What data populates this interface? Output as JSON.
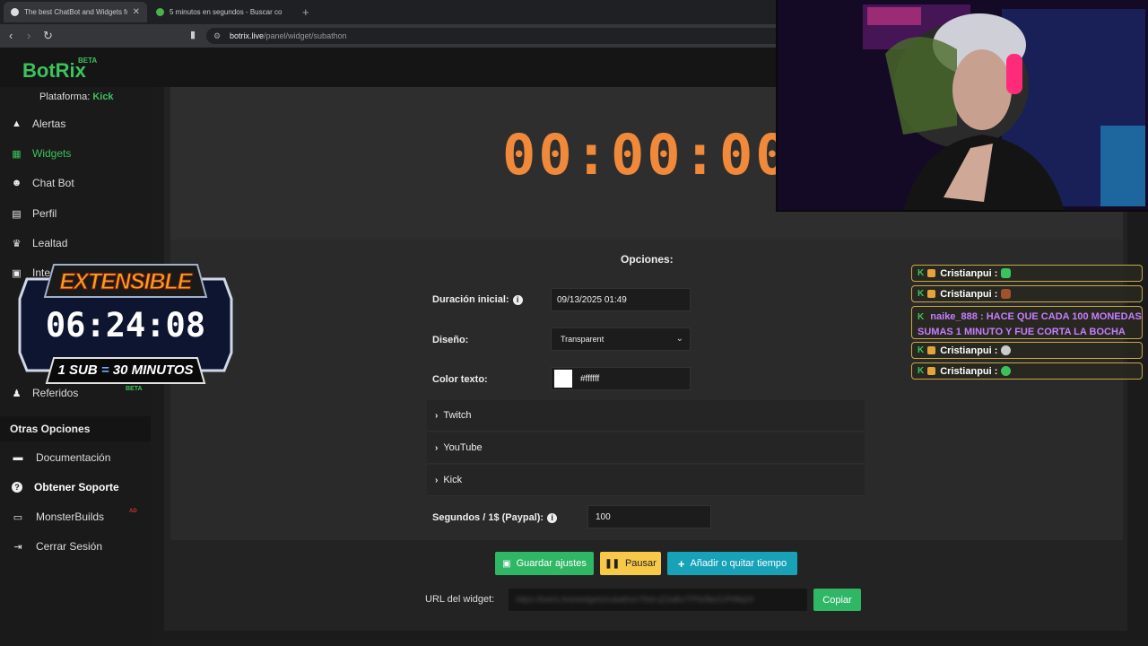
{
  "browser": {
    "tabs": [
      {
        "title": "The best ChatBot and Widgets fo",
        "active": true
      },
      {
        "title": "5 minutos en segundos - Buscar con",
        "active": false
      }
    ],
    "new_tab": "+",
    "url_host": "botrix.live",
    "url_path": "/panel/widget/subathon"
  },
  "header": {
    "logo": "BotRix",
    "logo_badge": "BETA"
  },
  "sidebar": {
    "platform_label": "Plataforma:",
    "platform_value": "Kick",
    "items": [
      {
        "label": "Alertas",
        "icon": "warning-icon"
      },
      {
        "label": "Widgets",
        "icon": "grid-icon"
      },
      {
        "label": "Chat Bot",
        "icon": "robot-icon"
      },
      {
        "label": "Perfil",
        "icon": "id-card-icon"
      },
      {
        "label": "Lealtad",
        "icon": "trophy-icon"
      },
      {
        "label": "Integ",
        "icon": "plug-icon"
      },
      {
        "label": "Referidos",
        "icon": "users-icon"
      }
    ],
    "referidos_badge": "BETA",
    "other_title": "Otras Opciones",
    "other_items": [
      {
        "label": "Documentación",
        "icon": "book-icon"
      },
      {
        "label": "Obtener Soporte",
        "icon": "question-icon"
      },
      {
        "label": "MonsterBuilds",
        "icon": "laptop-icon"
      },
      {
        "label": "Cerrar Sesión",
        "icon": "logout-icon"
      }
    ],
    "monster_badge": "AD"
  },
  "preview": {
    "timer": "00:00:00"
  },
  "options": {
    "title": "Opciones:",
    "duration_label": "Duración inicial:",
    "duration_value": "09/13/2025 01:49",
    "design_label": "Diseño:",
    "design_value": "Transparent",
    "color_label": "Color texto:",
    "color_value": "#ffffff",
    "accordions": [
      "Twitch",
      "YouTube",
      "Kick"
    ],
    "seconds_label": "Segundos / 1$ (Paypal):",
    "seconds_value": "100"
  },
  "actions": {
    "save": "Guardar ajustes",
    "pause": "Pausar",
    "add_time": "Añadir o quitar tiempo",
    "url_label": "URL del widget:",
    "url_value": "https://botrix.live/widgets/subathon?bid=jZ2a8vrTPN2BeZcP08q0X",
    "copy": "Copiar"
  },
  "overlay": {
    "title": "EXTENSIBLE",
    "timer": "06:24:08",
    "footer_left": "1 SUB",
    "footer_eq": "=",
    "footer_right": "30 MINUTOS"
  },
  "chat": [
    {
      "user": "Cristianpui :",
      "text": "",
      "emote_color": "#3cc25d"
    },
    {
      "user": "Cristianpui :",
      "text": "",
      "emote_color": "#a0522d"
    },
    {
      "user": "naike_888 :",
      "text": "HACE QUE CADA 100 MONEDAS SUMAS 1 MINUTO Y FUE CORTA LA BOCHA",
      "emote_color": ""
    },
    {
      "user": "Cristianpui :",
      "text": "",
      "emote_color": "#cccccc"
    },
    {
      "user": "Cristianpui :",
      "text": "",
      "emote_color": "#3cc25d"
    }
  ],
  "colors": {
    "accent_green": "#3cc25d",
    "timer_orange": "#f08a3a",
    "save_button": "#2fb765",
    "pause_button": "#f7c948",
    "add_button": "#17a2b8",
    "chat_purple": "#c77dff"
  }
}
